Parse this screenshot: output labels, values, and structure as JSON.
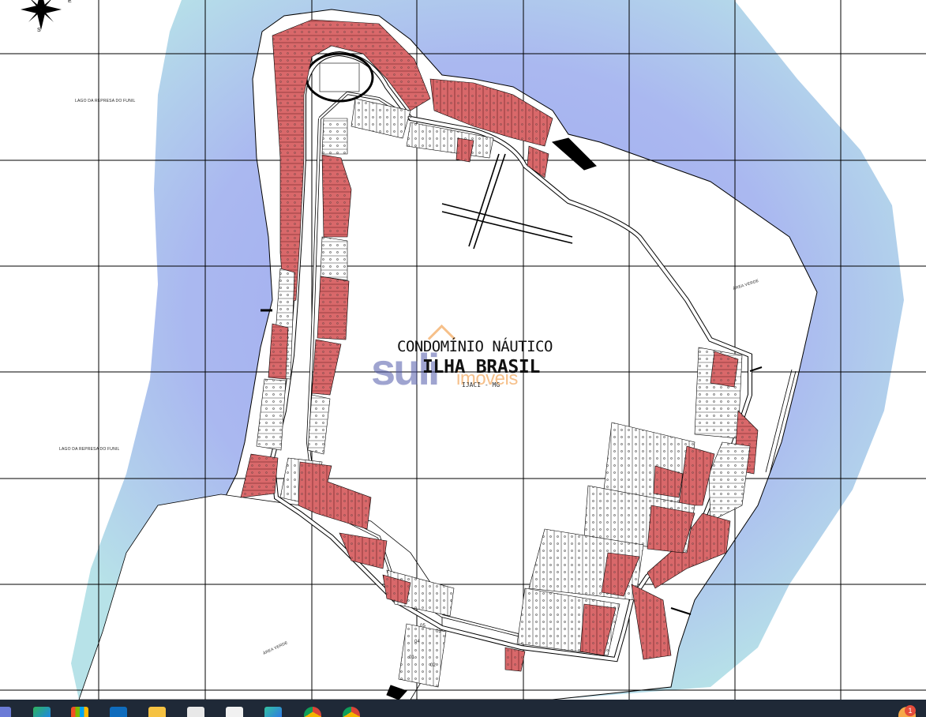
{
  "map": {
    "title_line1": "CONDOMÍNIO NÁUTICO",
    "title_line2": "ILHA BRASIL",
    "location": "IJACI - MG",
    "lake_label_top": "LAGO DA REPRESA DO FUNIL",
    "lake_label_bottom": "LAGO DA REPRESA DO FUNIL",
    "green_area_right": "ÁREA VERDE",
    "green_area_bottom": "ÁREA VERDE",
    "compass_east": "E",
    "compass_south": "S",
    "lot_numbers_visible": [
      "01",
      "02",
      "03",
      "04",
      "05"
    ]
  },
  "watermark": {
    "brand_main": "suli",
    "brand_sub": "imóveis"
  },
  "colors": {
    "water_inner": "#a9b6f0",
    "water_outer": "#b9e3e8",
    "lot_sold": "#d9686a",
    "lot_available": "#ffffff",
    "grid_line": "#000000",
    "taskbar": "#1f2937"
  },
  "taskbar": {
    "app_icons": [
      "task-view-icon",
      "edge-icon",
      "store-icon",
      "outlook-icon",
      "file-explorer-icon",
      "snipping-tool-icon",
      "paint-icon",
      "copilot-icon",
      "chrome-icon",
      "chrome-profile-icon"
    ],
    "notification_count": "1"
  }
}
